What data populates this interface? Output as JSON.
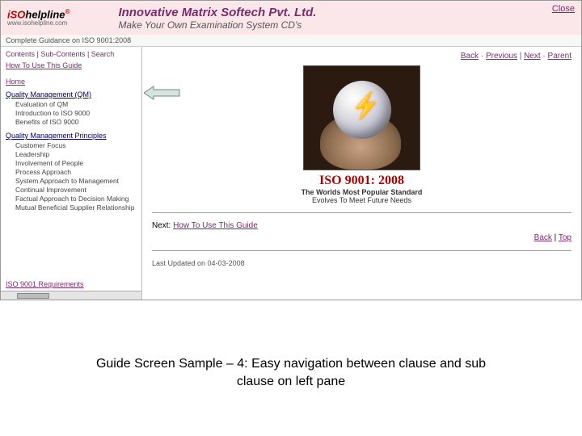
{
  "banner": {
    "logo_prefix": "iSO",
    "logo_suffix": "helpline",
    "logo_url": "www.isohelpline.com",
    "title": "Innovative Matrix Softech Pvt. Ltd.",
    "subtitle": "Make Your Own Examination System CD's",
    "close": "Close"
  },
  "subheader": "Complete Guidance on ISO 9001:2008",
  "sidebar": {
    "toprow": {
      "contents": "Contents",
      "sub": "Sub-Contents",
      "search": "Search"
    },
    "howto": "How To Use This Guide",
    "home": "Home",
    "section1": "Quality Management (QM)",
    "s1_items": [
      "Evaluation of QM",
      "Introduction to ISO 9000",
      "Benefits of ISO 9000"
    ],
    "section2": "Quality Management Principles",
    "s2_items": [
      "Customer Focus",
      "Leadership",
      "Involvement of People",
      "Process Approach",
      "System Approach to Management",
      "Continual Improvement",
      "Factual Approach to Decision Making",
      "Mutual Beneficial Supplier Relationship"
    ],
    "bottom": "ISO 9001 Requirements"
  },
  "main": {
    "nav": {
      "back": "Back",
      "previous": "Previous",
      "next": "Next",
      "parent": "Parent"
    },
    "iso_title": "ISO 9001: 2008",
    "iso_sub1": "The Worlds Most Popular Standard",
    "iso_sub2": "Evolves To Meet Future Needs",
    "next_label": "Next:",
    "next_link": "How To Use This Guide",
    "footer": {
      "back": "Back",
      "top": "Top"
    },
    "last_updated": "Last Updated on 04-03-2008"
  },
  "caption": {
    "l1": "Guide Screen Sample – 4: Easy navigation between clause and sub",
    "l2": "clause on left pane"
  }
}
